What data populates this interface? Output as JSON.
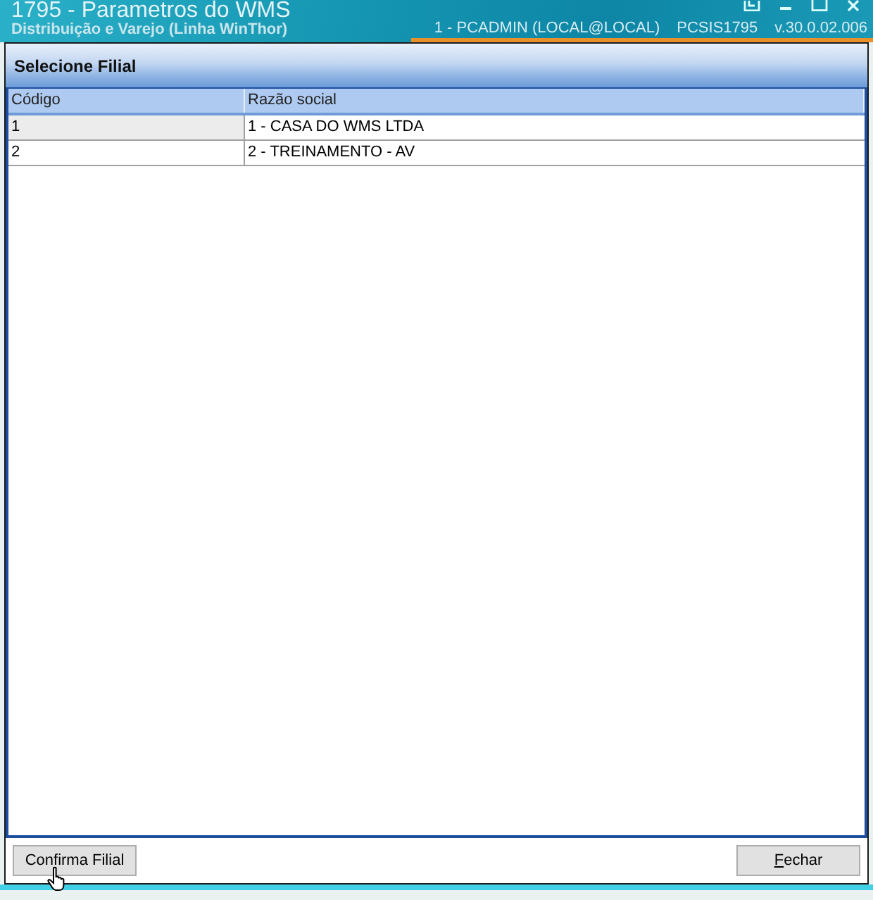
{
  "window": {
    "title": "1795 - Parametros do WMS",
    "subtitle": "Distribuição e Varejo (Linha WinThor)",
    "user": "1 - PCADMIN (LOCAL@LOCAL)",
    "program": "PCSIS1795",
    "version": "v.30.0.02.006"
  },
  "panel": {
    "title": "Selecione Filial"
  },
  "table": {
    "columns": [
      "Código",
      "Razão social"
    ],
    "rows": [
      {
        "cells": [
          "1",
          "1 - CASA DO WMS LTDA"
        ],
        "selected": true
      },
      {
        "cells": [
          "2",
          "2 - TREINAMENTO - AV"
        ],
        "selected": false
      }
    ]
  },
  "buttons": [
    {
      "label": "Confirma Filial",
      "mnemonic": false
    },
    {
      "label": "Fechar",
      "mnemonic": true
    }
  ]
}
